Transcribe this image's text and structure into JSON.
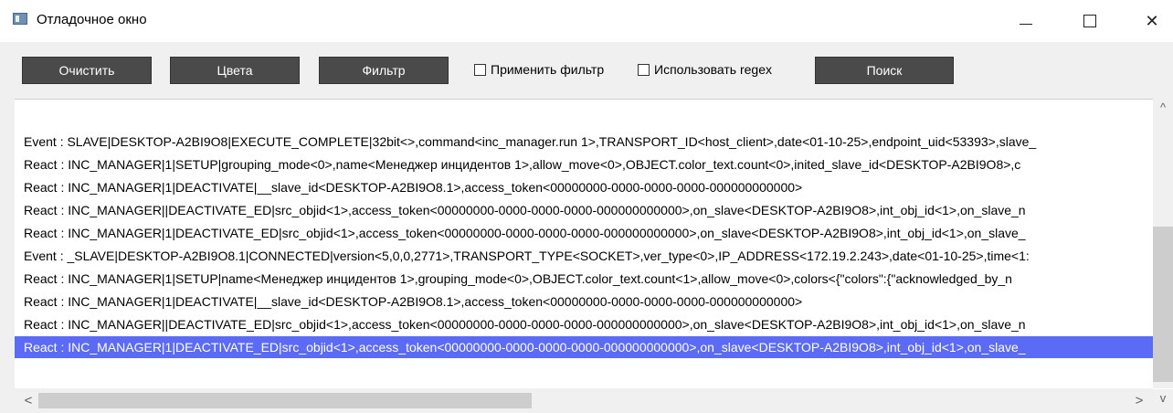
{
  "window": {
    "title": "Отладочное окно",
    "minimize_glyph": "—",
    "close_glyph": "✕"
  },
  "toolbar": {
    "clear_label": "Очистить",
    "colors_label": "Цвета",
    "filter_label": "Фильтр",
    "apply_filter_label": "Применить фильтр",
    "apply_filter_checked": false,
    "use_regex_label": "Использовать regex",
    "use_regex_checked": false,
    "search_label": "Поиск"
  },
  "log": {
    "lines": [
      "Event : SLAVE|DESKTOP-A2BI9O8|EXECUTE_COMPLETE|32bit<>,command<inc_manager.run 1>,TRANSPORT_ID<host_client>,date<01-10-25>,endpoint_uid<53393>,slave_",
      "React : INC_MANAGER|1|SETUP|grouping_mode<0>,name<Менеджер инцидентов 1>,allow_move<0>,OBJECT.color_text.count<0>,inited_slave_id<DESKTOP-A2BI9O8>,c",
      "React : INC_MANAGER|1|DEACTIVATE|__slave_id<DESKTOP-A2BI9O8.1>,access_token<00000000-0000-0000-0000-000000000000>",
      "React : INC_MANAGER||DEACTIVATE_ED|src_objid<1>,access_token<00000000-0000-0000-0000-000000000000>,on_slave<DESKTOP-A2BI9O8>,int_obj_id<1>,on_slave_n",
      "React : INC_MANAGER|1|DEACTIVATE_ED|src_objid<1>,access_token<00000000-0000-0000-0000-000000000000>,on_slave<DESKTOP-A2BI9O8>,int_obj_id<1>,on_slave_",
      "Event : _SLAVE|DESKTOP-A2BI9O8.1|CONNECTED|version<5,0,0,2771>,TRANSPORT_TYPE<SOCKET>,ver_type<0>,IP_ADDRESS<172.19.2.243>,date<01-10-25>,time<1:",
      "React : INC_MANAGER|1|SETUP|name<Менеджер инцидентов 1>,grouping_mode<0>,OBJECT.color_text.count<1>,allow_move<0>,colors<{\"colors\":{\"acknowledged_by_n",
      "React : INC_MANAGER|1|DEACTIVATE|__slave_id<DESKTOP-A2BI9O8.1>,access_token<00000000-0000-0000-0000-000000000000>",
      "React : INC_MANAGER||DEACTIVATE_ED|src_objid<1>,access_token<00000000-0000-0000-0000-000000000000>,on_slave<DESKTOP-A2BI9O8>,int_obj_id<1>,on_slave_n",
      "React : INC_MANAGER|1|DEACTIVATE_ED|src_objid<1>,access_token<00000000-0000-0000-0000-000000000000>,on_slave<DESKTOP-A2BI9O8>,int_obj_id<1>,on_slave_"
    ],
    "selected_index": 9,
    "selection_color": "#5b6bf5"
  },
  "scrollbars": {
    "up_glyph": "^",
    "down_glyph": "v",
    "left_glyph": "<",
    "right_glyph": ">"
  }
}
